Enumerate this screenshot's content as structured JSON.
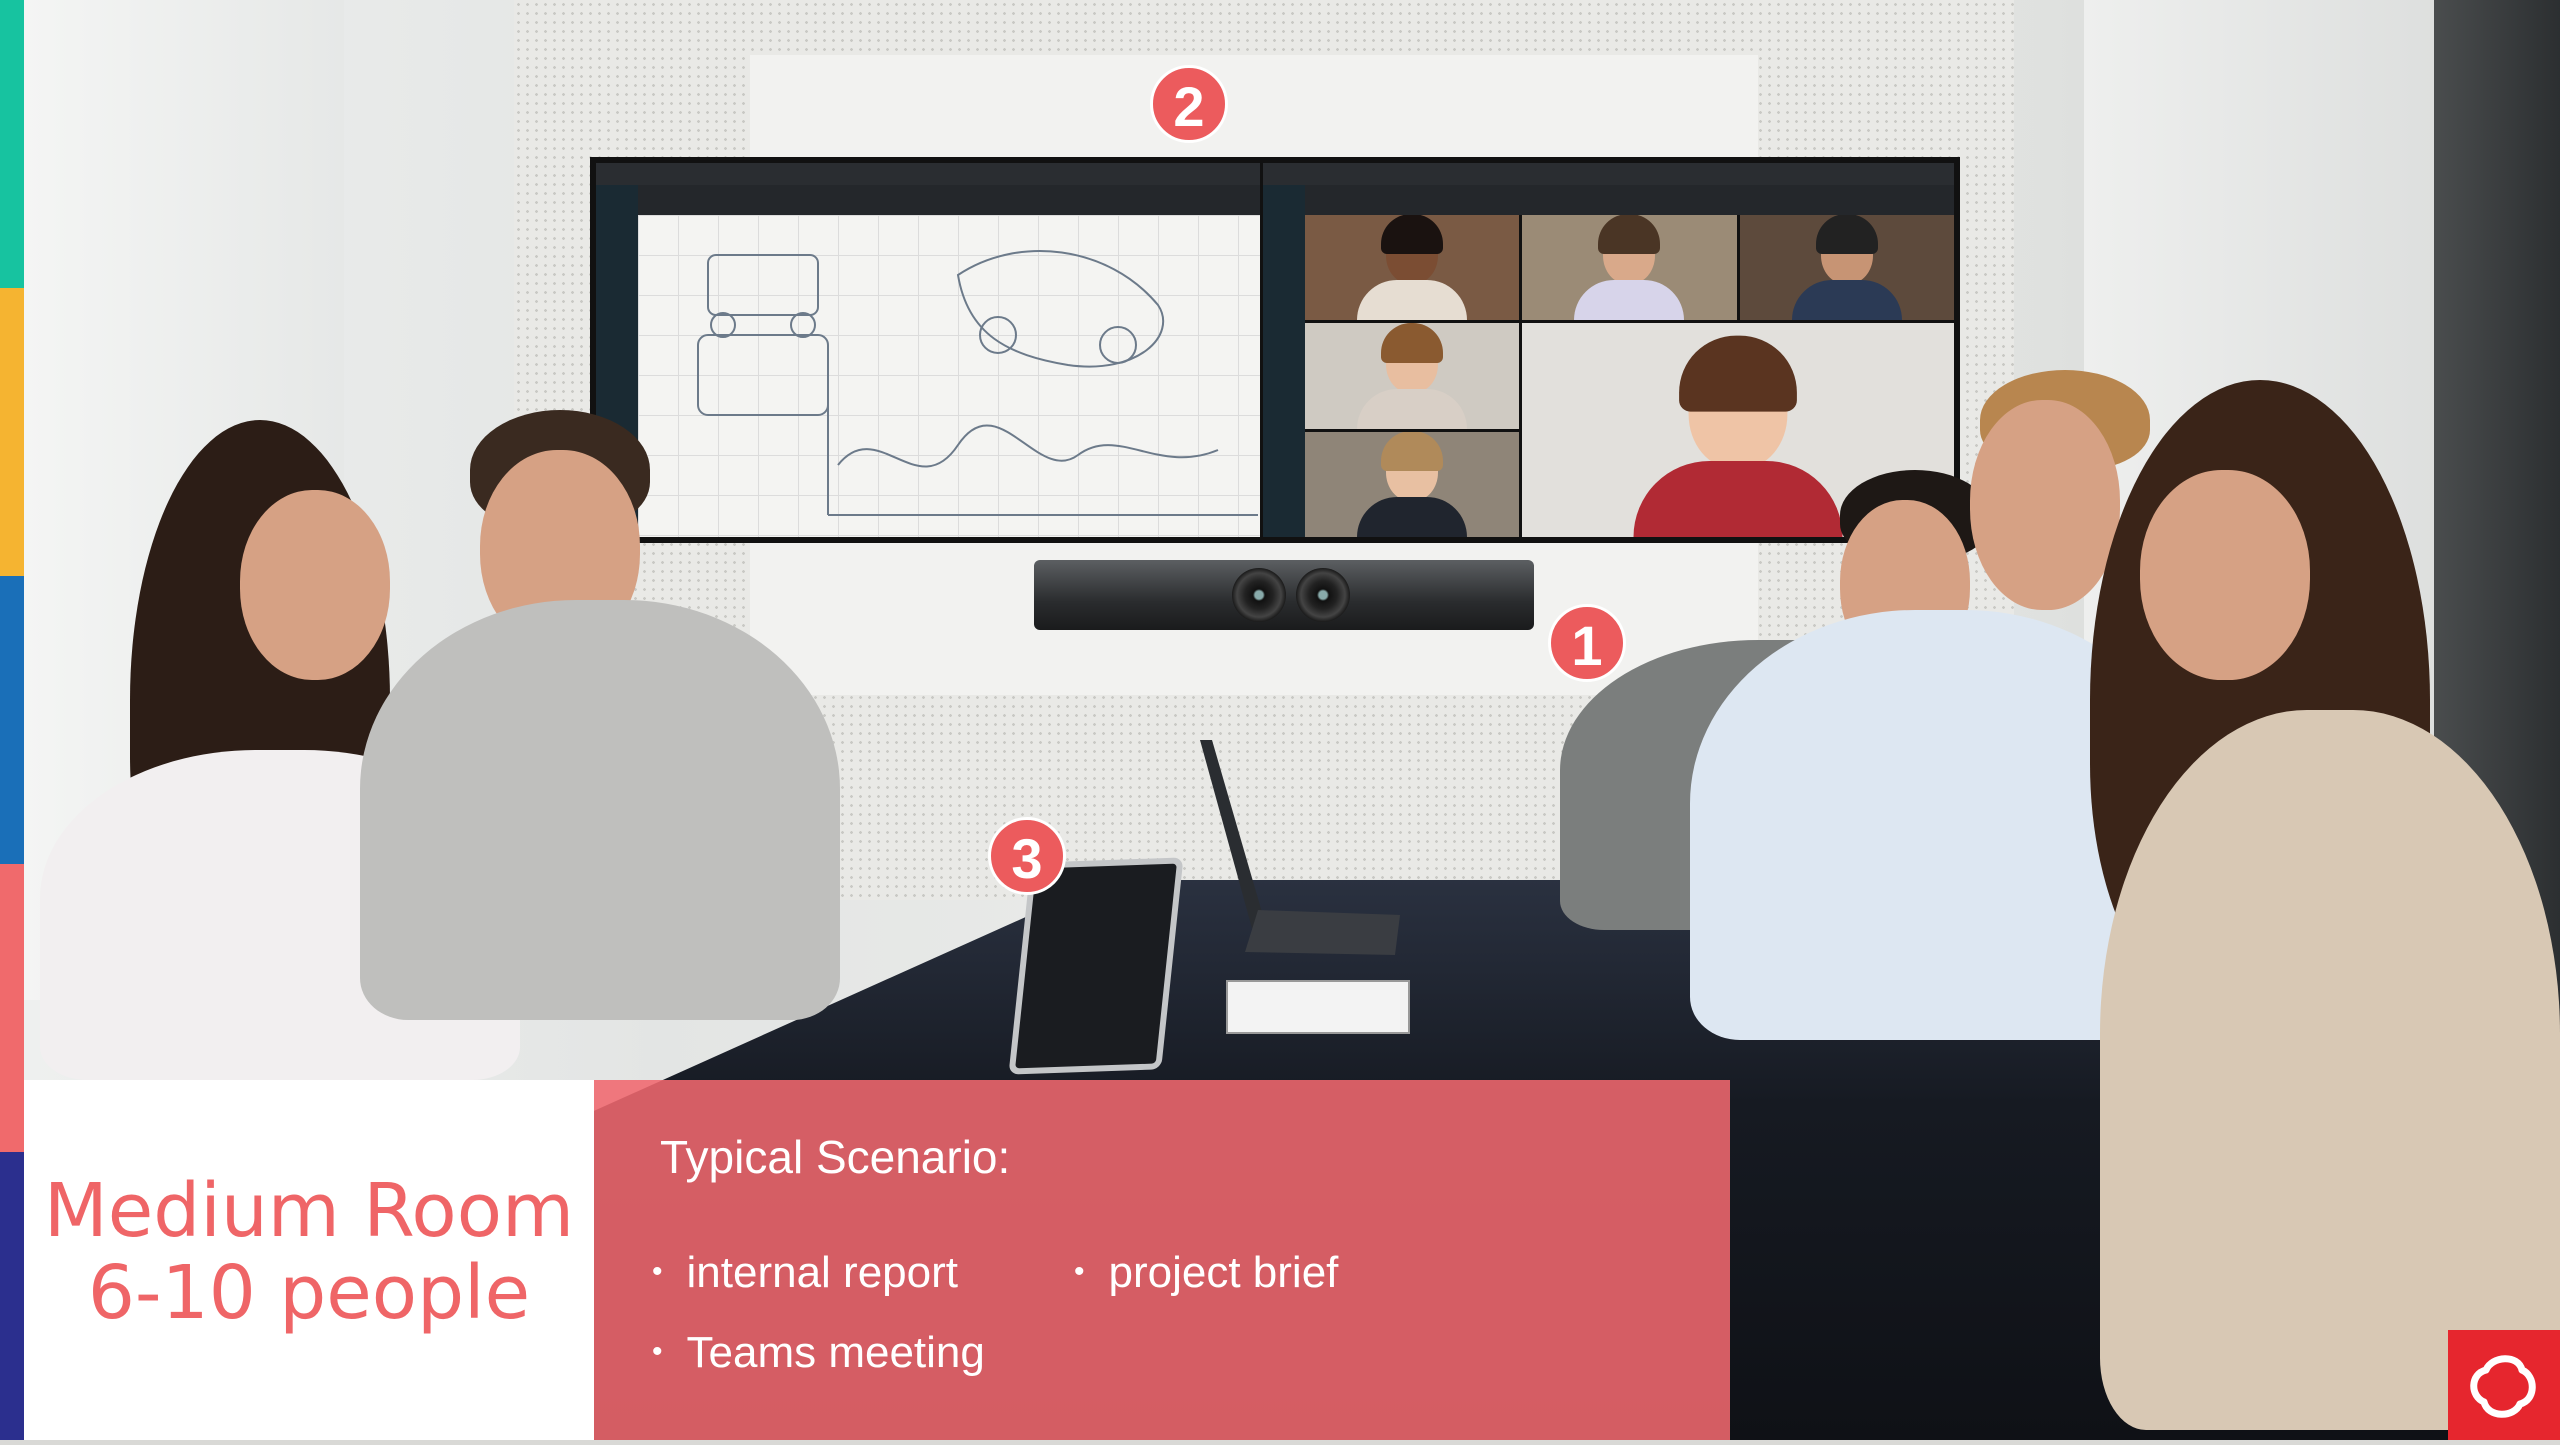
{
  "slide": {
    "room_title_line1": "Medium Room",
    "room_title_line2": "6-10 people",
    "scenario_heading": "Typical Scenario:",
    "scenarios": [
      "internal report",
      "project brief",
      "Teams meeting"
    ],
    "bullet_symbol": "•",
    "badges": [
      "1",
      "2",
      "3"
    ]
  },
  "colors": {
    "accent": "#ef6567",
    "caption_panel": "#f0686e",
    "badge": "#ec5b5d",
    "logo": "#e6262e",
    "strip": [
      "#17c3a0",
      "#f5b431",
      "#1a6fb8",
      "#f06a6c",
      "#2b2f8e"
    ]
  },
  "icons": {
    "logo": "brand-swirl-icon"
  }
}
